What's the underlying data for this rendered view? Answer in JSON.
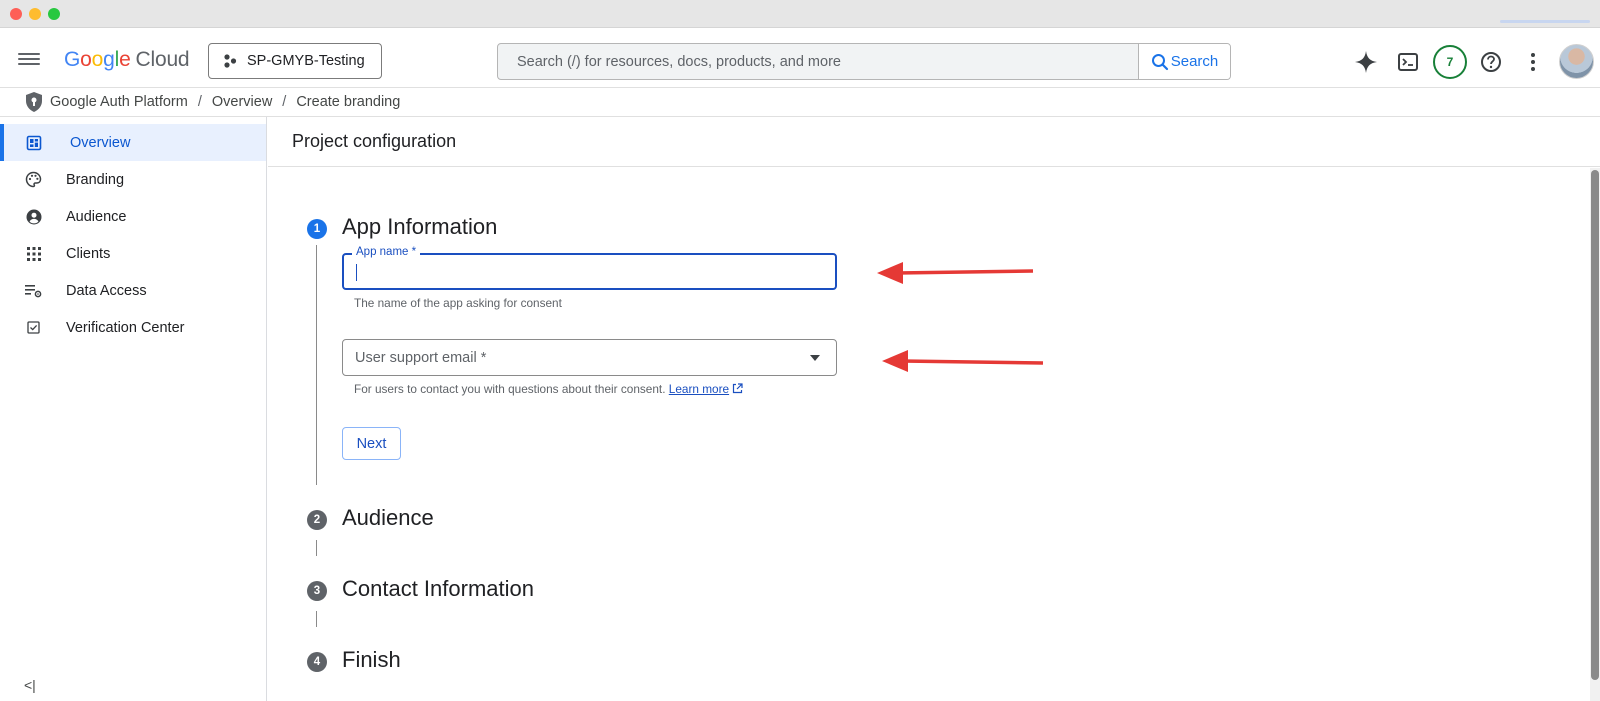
{
  "header": {
    "logo_google": [
      "G",
      "o",
      "o",
      "g",
      "l",
      "e"
    ],
    "logo_cloud": "Cloud",
    "project_name": "SP-GMYB-Testing",
    "search_placeholder": "Search (/) for resources, docs, products, and more",
    "search_button": "Search",
    "notification_count": "7",
    "icons": [
      "menu-icon",
      "gemini-sparkle-icon",
      "cloud-shell-icon",
      "help-icon",
      "more-vert-icon",
      "avatar"
    ]
  },
  "breadcrumb": {
    "items": [
      "Google Auth Platform",
      "Overview",
      "Create branding"
    ],
    "separator": "/"
  },
  "sidebar": {
    "items": [
      {
        "label": "Overview",
        "icon": "dashboard-icon",
        "active": true
      },
      {
        "label": "Branding",
        "icon": "palette-icon",
        "active": false
      },
      {
        "label": "Audience",
        "icon": "account-circle-icon",
        "active": false
      },
      {
        "label": "Clients",
        "icon": "apps-grid-icon",
        "active": false
      },
      {
        "label": "Data Access",
        "icon": "list-settings-icon",
        "active": false
      },
      {
        "label": "Verification Center",
        "icon": "checkbox-icon",
        "active": false
      }
    ],
    "collapse_label": "<|"
  },
  "main": {
    "title": "Project configuration",
    "steps": [
      {
        "number": "1",
        "title": "App Information",
        "active": true
      },
      {
        "number": "2",
        "title": "Audience",
        "active": false
      },
      {
        "number": "3",
        "title": "Contact Information",
        "active": false
      },
      {
        "number": "4",
        "title": "Finish",
        "active": false
      }
    ],
    "app_name": {
      "label": "App name *",
      "value": "",
      "helper": "The name of the app asking for consent"
    },
    "support_email": {
      "placeholder": "User support email *",
      "helper": "For users to contact you with questions about their consent.",
      "learn_more": "Learn more"
    },
    "next_button": "Next"
  },
  "colors": {
    "accent": "#1a73e8",
    "annotation_arrow": "#e53935"
  }
}
